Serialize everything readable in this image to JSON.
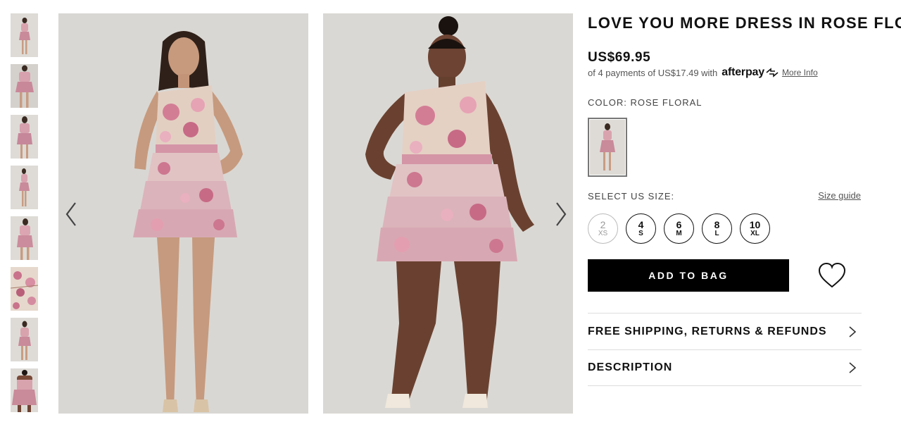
{
  "product": {
    "title": "LOVE YOU MORE DRESS IN ROSE FLORAL",
    "price": "US$69.95",
    "installments_prefix": "of 4 payments of US$17.49 with",
    "afterpay_brand": "afterpay",
    "more_info": "More Info",
    "color_label": "COLOR: ROSE FLORAL",
    "size_label": "SELECT US SIZE:",
    "size_guide": "Size guide",
    "sizes": [
      {
        "num": "2",
        "letter": "XS",
        "available": false
      },
      {
        "num": "4",
        "letter": "S",
        "available": true
      },
      {
        "num": "6",
        "letter": "M",
        "available": true
      },
      {
        "num": "8",
        "letter": "L",
        "available": true
      },
      {
        "num": "10",
        "letter": "XL",
        "available": true
      }
    ],
    "add_to_bag": "ADD TO BAG",
    "accordions": [
      "FREE SHIPPING, RETURNS & REFUNDS",
      "DESCRIPTION"
    ]
  },
  "gallery": {
    "thumbnail_count": 8,
    "main_images": [
      "model-front-view",
      "model-curve-front-view"
    ]
  },
  "icons": {
    "prev": "chevron-left-icon",
    "next": "chevron-right-icon",
    "wishlist": "heart-icon",
    "accordion": "chevron-right-icon"
  },
  "colors": {
    "button_bg": "#000000",
    "dress_pink": "#d98aa0",
    "dress_cream": "#e8dcd0",
    "photo_bg": "#d9d7d3"
  }
}
